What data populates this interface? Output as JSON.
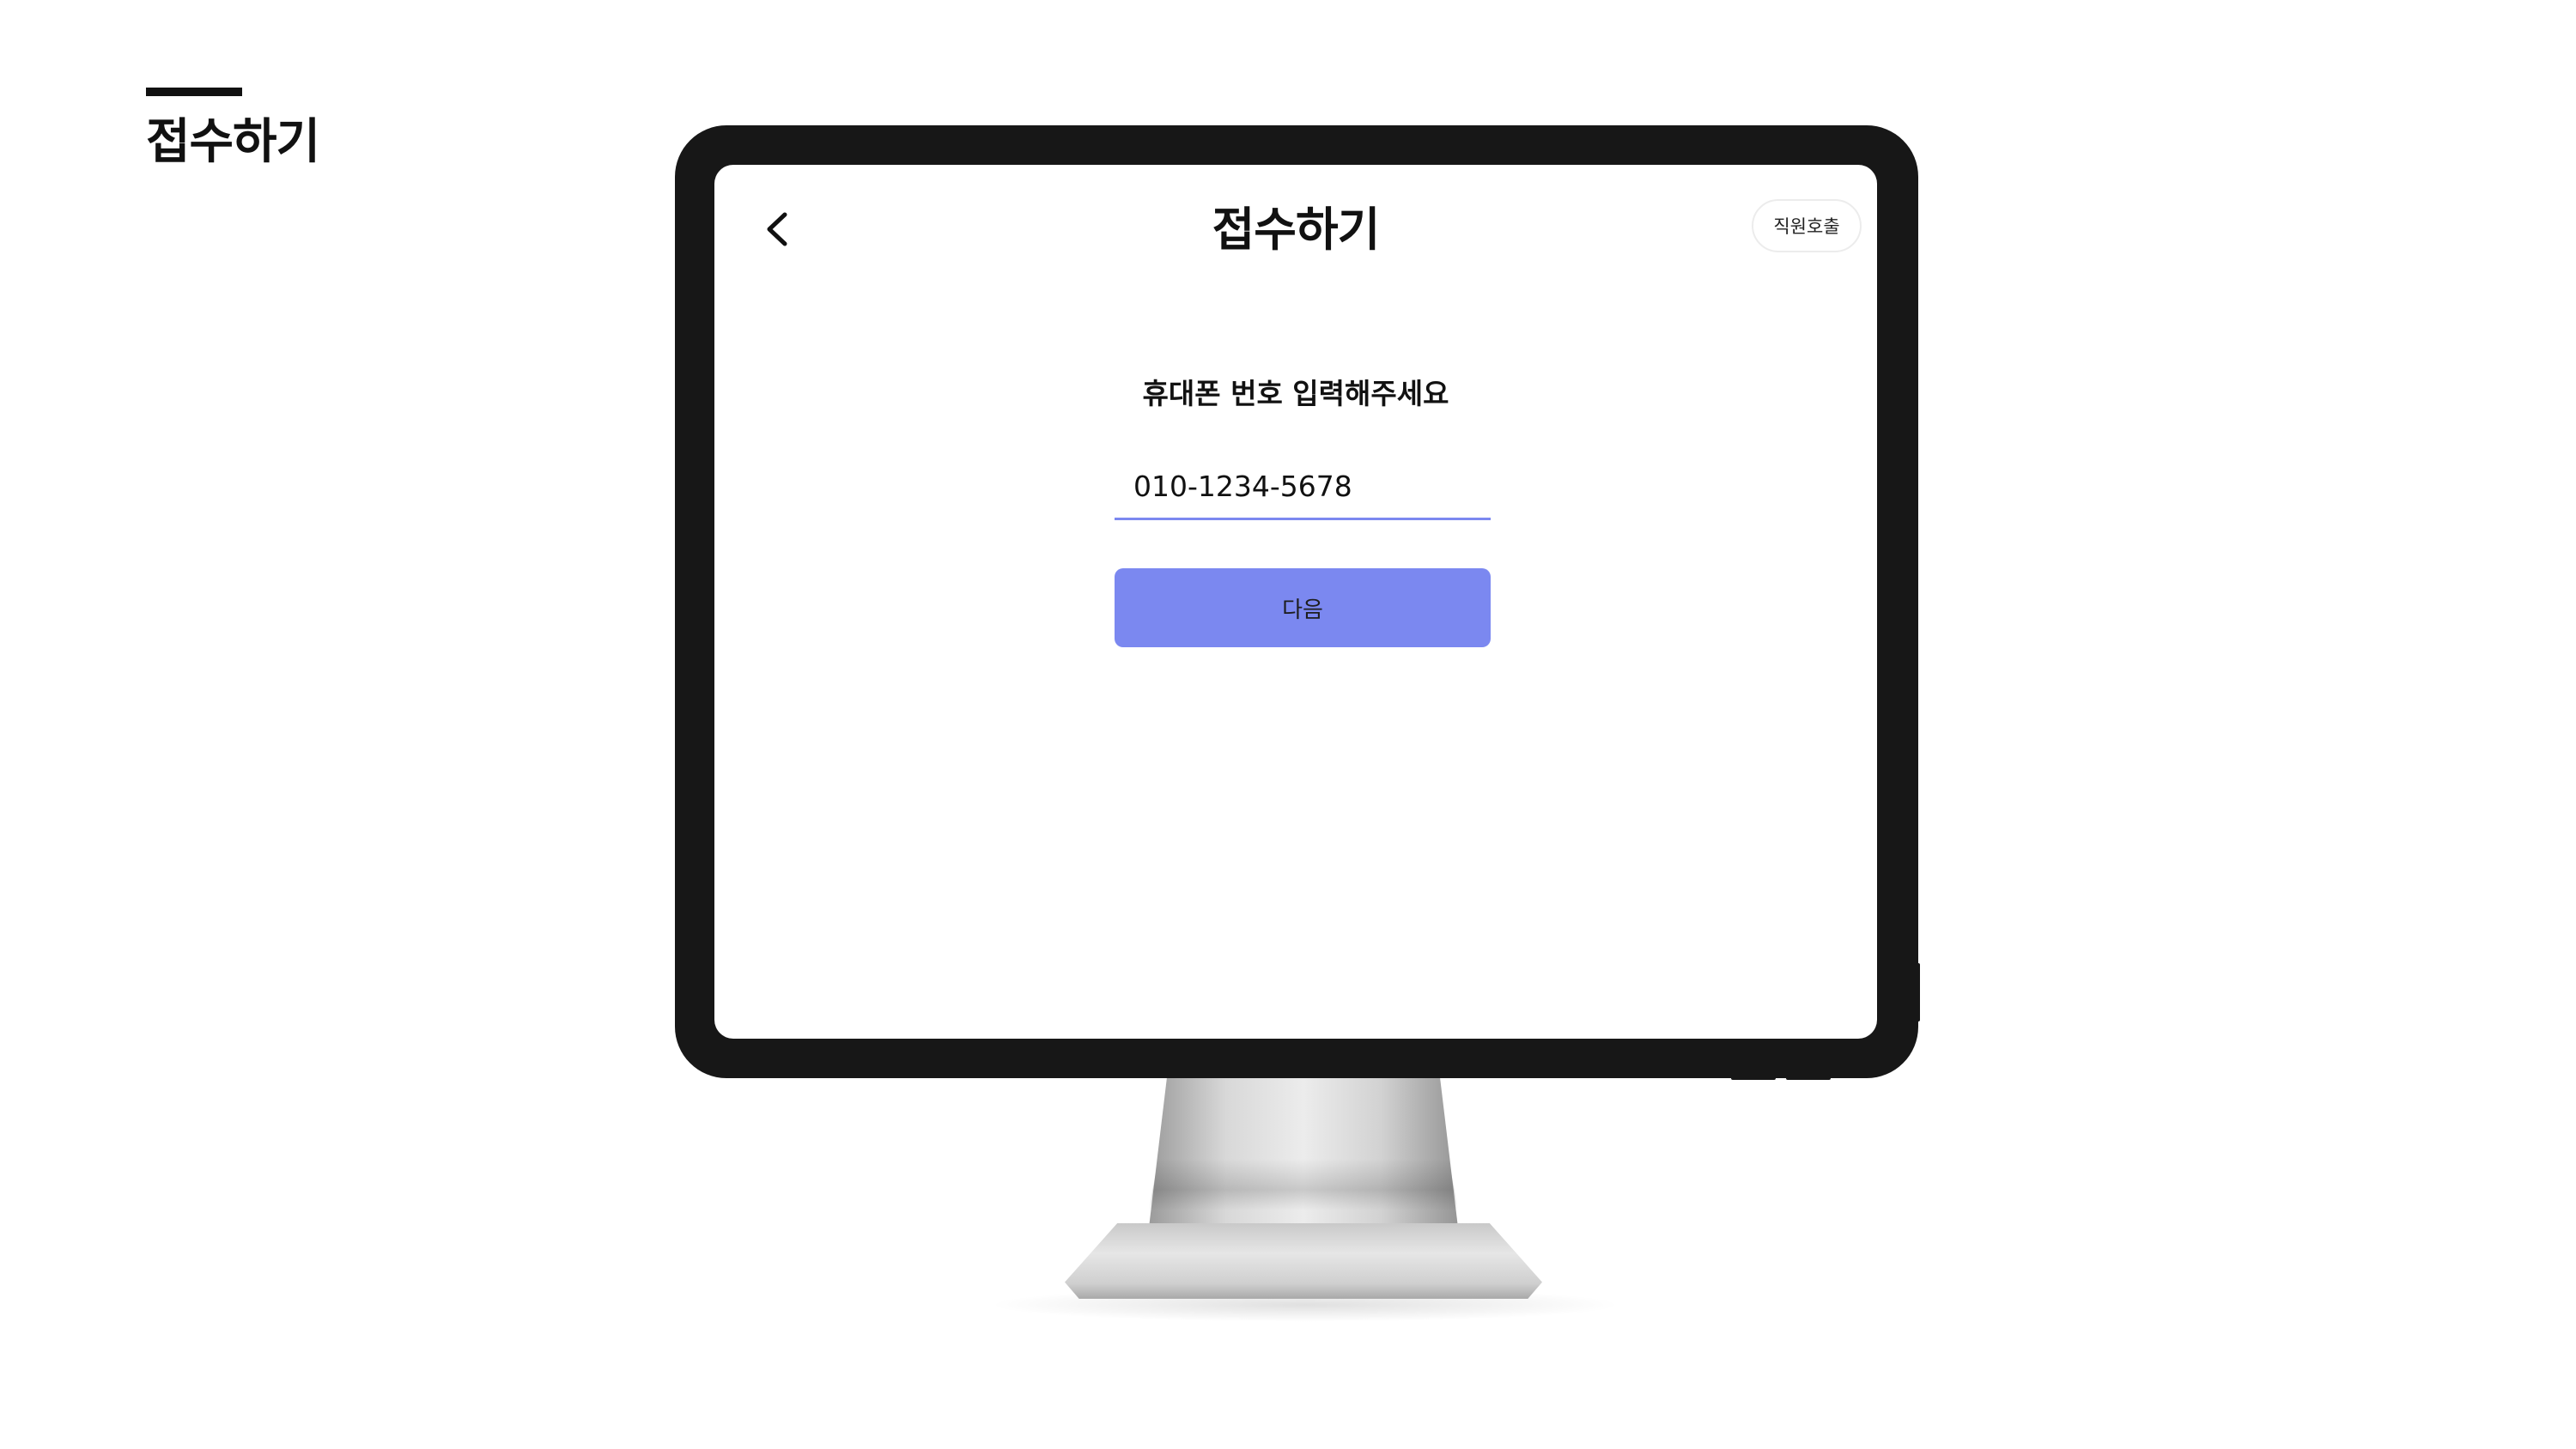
{
  "slide": {
    "title": "접수하기"
  },
  "screen": {
    "title": "접수하기",
    "back_icon": "chevron-left-icon",
    "staff_call_label": "직원호출",
    "prompt": "휴대폰 번호 입력해주세요",
    "phone_input_value": "010-1234-5678",
    "next_label": "다음"
  },
  "colors": {
    "accent": "#7b88f0",
    "bezel": "#171717",
    "text": "#111111"
  }
}
